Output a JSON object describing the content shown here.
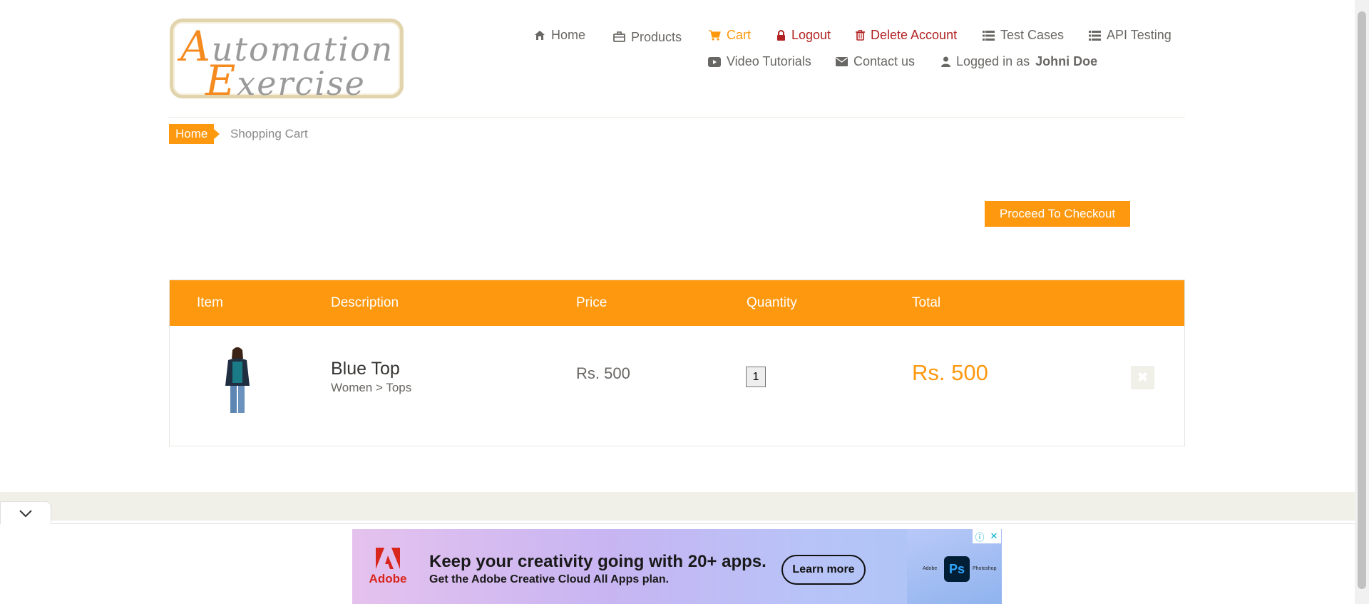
{
  "logo": {
    "line1_cap": "A",
    "line1_rest": "utomation",
    "line2_cap": "E",
    "line2_rest": "xercise"
  },
  "nav": {
    "row1": [
      {
        "label": "Home",
        "icon": "home-icon"
      },
      {
        "label": "Products",
        "icon": "briefcase-icon"
      },
      {
        "label": "Cart",
        "icon": "cart-icon"
      },
      {
        "label": "Logout",
        "icon": "lock-icon"
      },
      {
        "label": "Delete Account",
        "icon": "trash-icon"
      },
      {
        "label": "Test Cases",
        "icon": "list-icon"
      },
      {
        "label": "API Testing",
        "icon": "list-icon"
      }
    ],
    "row2": [
      {
        "label": "Video Tutorials",
        "icon": "youtube-icon"
      },
      {
        "label": "Contact us",
        "icon": "envelope-icon"
      },
      {
        "label": "Logged in as",
        "icon": "user-icon",
        "user": "Johni Doe"
      }
    ]
  },
  "breadcrumb": {
    "home": "Home",
    "current": "Shopping Cart"
  },
  "checkout": {
    "label": "Proceed To Checkout"
  },
  "cart_table": {
    "headers": [
      "Item",
      "Description",
      "Price",
      "Quantity",
      "Total"
    ],
    "rows": [
      {
        "name": "Blue Top",
        "category": "Women > Tops",
        "price": "Rs. 500",
        "quantity": "1",
        "total": "Rs. 500"
      }
    ]
  },
  "ad": {
    "brand": "Adobe",
    "headline": "Keep your creativity going with 20+ apps.",
    "subline": "Get the Adobe Creative Cloud All Apps plan.",
    "cta": "Learn more",
    "app_icon": "Ps",
    "mini_left": "Adobe",
    "mini_right": "Photoshop",
    "info": "ⓘ",
    "close": "✕"
  },
  "colors": {
    "accent": "#fe980f",
    "danger": "#b22222",
    "text": "#696763"
  }
}
